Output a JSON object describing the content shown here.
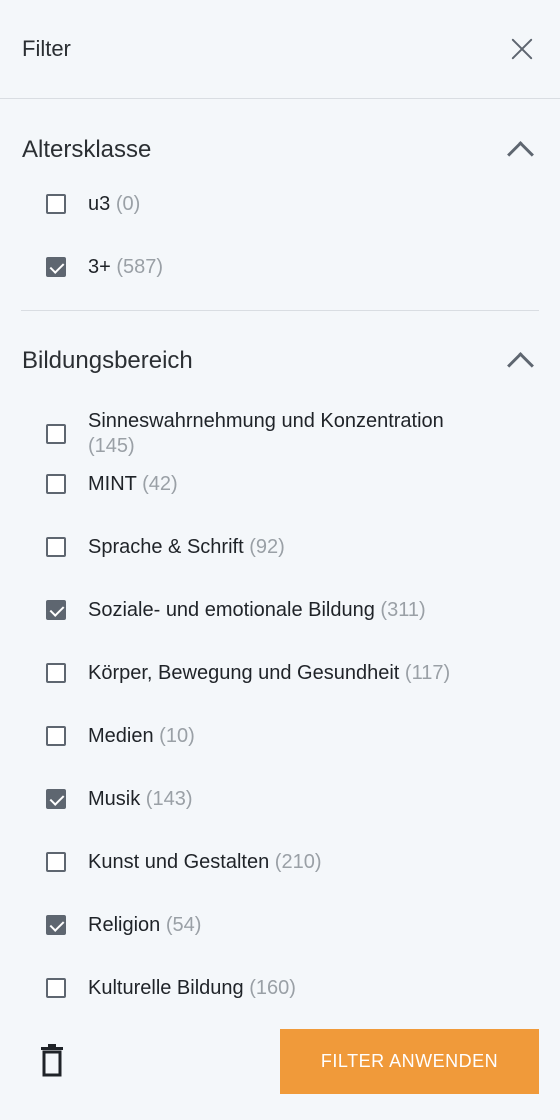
{
  "header": {
    "title": "Filter"
  },
  "sections": [
    {
      "title": "Altersklasse",
      "options": [
        {
          "label": "u3",
          "count": "(0)",
          "checked": false
        },
        {
          "label": "3+",
          "count": "(587)",
          "checked": true
        }
      ]
    },
    {
      "title": "Bildungsbereich",
      "options": [
        {
          "label": "Sinneswahrnehmung und Konzentration",
          "count": "(145)",
          "checked": false
        },
        {
          "label": "MINT",
          "count": "(42)",
          "checked": false
        },
        {
          "label": "Sprache & Schrift",
          "count": "(92)",
          "checked": false
        },
        {
          "label": "Soziale- und emotionale Bildung",
          "count": "(311)",
          "checked": true
        },
        {
          "label": "Körper, Bewegung und Gesundheit",
          "count": "(117)",
          "checked": false
        },
        {
          "label": "Medien",
          "count": "(10)",
          "checked": false
        },
        {
          "label": "Musik",
          "count": "(143)",
          "checked": true
        },
        {
          "label": "Kunst und Gestalten",
          "count": "(210)",
          "checked": false
        },
        {
          "label": "Religion",
          "count": "(54)",
          "checked": true
        },
        {
          "label": "Kulturelle Bildung",
          "count": "(160)",
          "checked": false
        }
      ]
    }
  ],
  "footer": {
    "apply_label": "FILTER ANWENDEN"
  },
  "colors": {
    "accent": "#f09a3a",
    "checkbox": "#5e6670",
    "count": "#9aa0a6",
    "background": "#f4f7fa"
  }
}
